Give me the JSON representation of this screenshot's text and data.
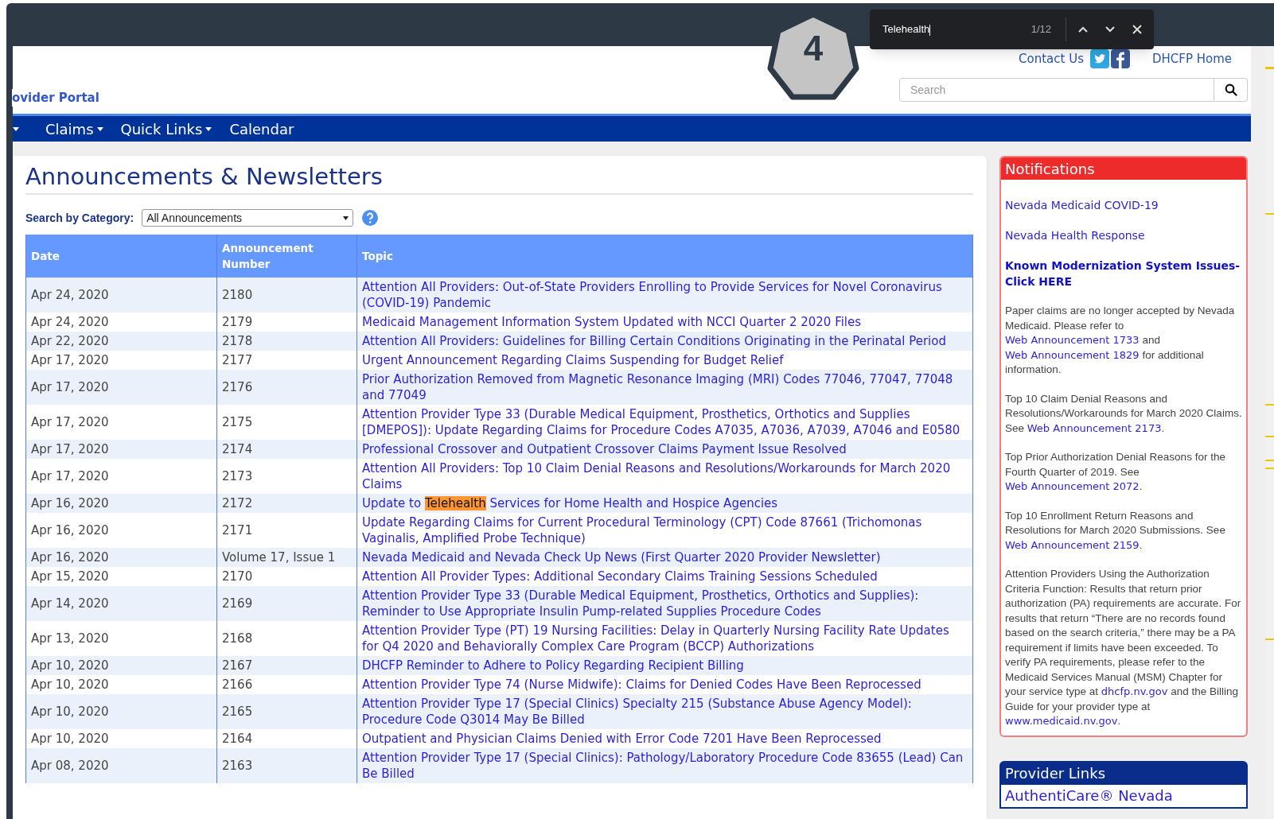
{
  "find_bar": {
    "query": "Telehealth",
    "count": "1/12"
  },
  "step_badge": "4",
  "header": {
    "portal_title": "ovider Portal",
    "contact": "Contact Us",
    "home": "DHCFP Home",
    "search": {
      "placeholder": "Search"
    }
  },
  "nav": [
    {
      "label": "Claims",
      "dropdown": true
    },
    {
      "label": "Quick Links",
      "dropdown": true
    },
    {
      "label": "Calendar",
      "dropdown": false
    }
  ],
  "main": {
    "title": "Announcements & Newsletters",
    "filter_label": "Search by Category:",
    "filter_value": "All Announcements",
    "columns": [
      "Date",
      "Announcement Number",
      "Topic"
    ],
    "rows": [
      {
        "date": "Apr 24, 2020",
        "number": "2180",
        "topic": [
          {
            "text": "Attention All Providers: Out-of-State Providers Enrolling to Provide Services for Novel Coronavirus (COVID-19) Pandemic",
            "highlighted": false
          }
        ]
      },
      {
        "date": "Apr 24, 2020",
        "number": "2179",
        "topic": [
          {
            "text": "Medicaid Management Information System Updated with NCCI Quarter 2 2020 Files",
            "highlighted": false
          }
        ]
      },
      {
        "date": "Apr 22, 2020",
        "number": "2178",
        "topic": [
          {
            "text": "Attention All Providers: Guidelines for Billing Certain Conditions Originating in the Perinatal Period",
            "highlighted": false
          }
        ]
      },
      {
        "date": "Apr 17, 2020",
        "number": "2177",
        "topic": [
          {
            "text": "Urgent Announcement Regarding Claims Suspending for Budget Relief",
            "highlighted": false
          }
        ]
      },
      {
        "date": "Apr 17, 2020",
        "number": "2176",
        "topic": [
          {
            "text": "Prior Authorization Removed from Magnetic Resonance Imaging (MRI) Codes 77046, 77047, 77048 and 77049",
            "highlighted": false
          }
        ]
      },
      {
        "date": "Apr 17, 2020",
        "number": "2175",
        "topic": [
          {
            "text": "Attention Provider Type 33 (Durable Medical Equipment, Prosthetics, Orthotics and Supplies [DMEPOS]): Update Regarding Claims for Procedure Codes A7035, A7036, A7039, A7046 and E0580",
            "highlighted": false
          }
        ]
      },
      {
        "date": "Apr 17, 2020",
        "number": "2174",
        "topic": [
          {
            "text": "Professional Crossover and Outpatient Crossover Claims Payment Issue Resolved",
            "highlighted": false
          }
        ]
      },
      {
        "date": "Apr 17, 2020",
        "number": "2173",
        "topic": [
          {
            "text": "Attention All Providers: Top 10 Claim Denial Reasons and Resolutions/Workarounds for March 2020 Claims",
            "highlighted": false
          }
        ]
      },
      {
        "date": "Apr 16, 2020",
        "number": "2172",
        "topic": [
          {
            "text": "Update to ",
            "highlighted": false
          },
          {
            "text": "Telehealth",
            "highlighted": true
          },
          {
            "text": " Services for Home Health and Hospice Agencies",
            "highlighted": false
          }
        ]
      },
      {
        "date": "Apr 16, 2020",
        "number": "2171",
        "topic": [
          {
            "text": "Update Regarding Claims for Current Procedural Terminology (CPT) Code 87661 (Trichomonas Vaginalis, Amplified Probe Technique)",
            "highlighted": false
          }
        ]
      },
      {
        "date": "Apr 16, 2020",
        "number": "Volume 17, Issue 1",
        "topic": [
          {
            "text": "Nevada Medicaid and Nevada Check Up News (First Quarter 2020 Provider Newsletter)",
            "highlighted": false
          }
        ]
      },
      {
        "date": "Apr 15, 2020",
        "number": "2170",
        "topic": [
          {
            "text": "Attention All Provider Types: Additional Secondary Claims Training Sessions Scheduled",
            "highlighted": false
          }
        ]
      },
      {
        "date": "Apr 14, 2020",
        "number": "2169",
        "topic": [
          {
            "text": "Attention Provider Type 33 (Durable Medical Equipment, Prosthetics, Orthotics and Supplies): Reminder to Use Appropriate Insulin Pump-related Supplies Procedure Codes",
            "highlighted": false
          }
        ]
      },
      {
        "date": "Apr 13, 2020",
        "number": "2168",
        "topic": [
          {
            "text": "Attention Provider Type (PT) 19 Nursing Facilities: Delay in Quarterly Nursing Facility Rate Updates for Q4 2020 and Behaviorally Complex Care Program (BCCP) Authorizations",
            "highlighted": false
          }
        ]
      },
      {
        "date": "Apr 10, 2020",
        "number": "2167",
        "topic": [
          {
            "text": "DHCFP Reminder to Adhere to Policy Regarding Recipient Billing",
            "highlighted": false
          }
        ]
      },
      {
        "date": "Apr 10, 2020",
        "number": "2166",
        "topic": [
          {
            "text": "Attention Provider Type 74 (Nurse Midwife): Claims for Denied Codes Have Been Reprocessed",
            "highlighted": false
          }
        ]
      },
      {
        "date": "Apr 10, 2020",
        "number": "2165",
        "topic": [
          {
            "text": "Attention Provider Type 17 (Special Clinics) Specialty 215 (Substance Abuse Agency Model): Procedure Code Q3014 May Be Billed",
            "highlighted": false
          }
        ]
      },
      {
        "date": "Apr 10, 2020",
        "number": "2164",
        "topic": [
          {
            "text": "Outpatient and Physician Claims Denied with Error Code 7201 Have Been Reprocessed",
            "highlighted": false
          }
        ]
      },
      {
        "date": "Apr 08, 2020",
        "number": "2163",
        "topic": [
          {
            "text": "Attention Provider Type 17 (Special Clinics): Pathology/Laboratory Procedure Code 83655 (Lead) Can Be Billed",
            "highlighted": false
          }
        ]
      }
    ]
  },
  "notifications": {
    "title": "Notifications",
    "items": [
      [
        {
          "kind": "link",
          "text": "Nevada Medicaid COVID-19"
        }
      ],
      [
        {
          "kind": "link",
          "text": "Nevada Health Response"
        }
      ],
      [
        {
          "kind": "bold_link",
          "text": "Known Modernization System Issues-Click HERE"
        }
      ],
      [
        {
          "kind": "text",
          "text": "Paper claims are no longer accepted by Nevada Medicaid. Please refer to "
        },
        {
          "kind": "link",
          "text": "Web Announcement 1733"
        },
        {
          "kind": "text",
          "text": " and "
        },
        {
          "kind": "link",
          "text": "Web Announcement 1829"
        },
        {
          "kind": "text",
          "text": " for additional information."
        }
      ],
      [
        {
          "kind": "text",
          "text": "Top 10 Claim Denial Reasons and Resolutions/Workarounds for March 2020 Claims. See "
        },
        {
          "kind": "link",
          "text": "Web Announcement 2173"
        },
        {
          "kind": "text",
          "text": "."
        }
      ],
      [
        {
          "kind": "text",
          "text": "Top Prior Authorization Denial Reasons for the Fourth Quarter of 2019. See "
        },
        {
          "kind": "link",
          "text": "Web Announcement 2072"
        },
        {
          "kind": "text",
          "text": "."
        }
      ],
      [
        {
          "kind": "text",
          "text": "Top 10 Enrollment Return Reasons and Resolutions for March 2020 Submissions. See "
        },
        {
          "kind": "link",
          "text": "Web Announcement 2159"
        },
        {
          "kind": "text",
          "text": "."
        }
      ],
      [
        {
          "kind": "text",
          "text": "Attention Providers Using the Authorization Criteria Function: Results that return prior authorization (PA) requirements are accurate. For results that return “There are no records found based on the search criteria,” there may be a PA requirement if limits have been exceeded. To verify PA requirements, please refer to the Medicaid Services Manual (MSM) Chapter for your service type at "
        },
        {
          "kind": "link",
          "text": "dhcfp.nv.gov"
        },
        {
          "kind": "text",
          "text": " and the Billing Guide for your provider type at "
        },
        {
          "kind": "link",
          "text": "www.medicaid.nv.gov"
        },
        {
          "kind": "text",
          "text": "."
        }
      ]
    ]
  },
  "provider_links": {
    "title": "Provider Links",
    "items": [
      "AuthentiCare® Nevada"
    ]
  }
}
